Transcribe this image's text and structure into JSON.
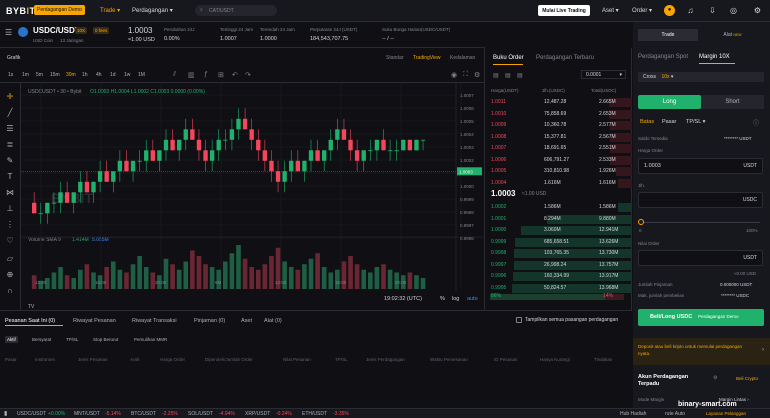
{
  "topnav": {
    "logo_a": "BYB",
    "logo_b": "I",
    "logo_c": "T",
    "demo_badge": "Perdagangan Demo",
    "trade": "Trade",
    "perdagangan": "Perdagangan",
    "search_placeholder": "CAT/USDT",
    "live_btn": "Mulai Live Trading",
    "aset": "Aset",
    "order": "Order"
  },
  "ticker": {
    "symbol": "USDC/USDT",
    "badge_lev": "10X",
    "badge_fee": "0 fees",
    "sub": "USD Coin",
    "sub2": "13 Jaringan",
    "last_price": "1.0003",
    "last_usd": "≈1.00 USD",
    "stats": [
      {
        "label": "Perubahan 24J",
        "value": "0.00%"
      },
      {
        "label": "Tertinggi 24 Jam",
        "value": "1.0007"
      },
      {
        "label": "Terendah 24 Jam",
        "value": "1.0000"
      },
      {
        "label": "Perputaran 24J (USDT)",
        "value": "184,543,707.75"
      },
      {
        "label": "Suku Bunga Harian(USDC/USDT)",
        "value": "-- / --"
      }
    ]
  },
  "chart": {
    "title": "Grafik",
    "views": [
      "Standar",
      "TradingView",
      "Kedalaman"
    ],
    "intervals": [
      "1s",
      "1m",
      "5m",
      "15m",
      "30m",
      "1h",
      "4h",
      "1d",
      "1w",
      "1M"
    ],
    "active_interval": "30m",
    "ohlc_line": "USDCUSDT • 30 • Bybit",
    "ohlc": "O1.0003 H1.0004 L1.0002 C1.0003 0.0000 (0.00%)",
    "volume_label": "Volume SMA 9",
    "vol_a": "1.414M",
    "vol_b": "5.055M",
    "watermark": "BYBIT",
    "yticks": [
      "1.0007",
      "1.0006",
      "1.0005",
      "1.0004",
      "1.0003",
      "1.0002",
      "1.0001",
      "1.0000",
      "0.9999",
      "0.9998",
      "0.9997",
      "0.9996"
    ],
    "price_tag": "1.0003",
    "time_axis": [
      "12:00",
      "16:00",
      "20:00",
      "6M",
      "12:00",
      "16:00",
      "20:00"
    ],
    "clock": "19:02:32 (UTC)",
    "log": "log",
    "auto": "auto",
    "candles": [
      [
        2,
        3,
        1,
        1
      ],
      [
        1,
        2,
        0,
        1
      ],
      [
        1,
        2,
        0,
        2
      ],
      [
        2,
        3,
        1,
        2
      ],
      [
        2,
        4,
        1,
        3
      ],
      [
        3,
        4,
        2,
        2
      ],
      [
        2,
        3,
        1,
        3
      ],
      [
        3,
        5,
        2,
        4
      ],
      [
        4,
        5,
        3,
        3
      ],
      [
        3,
        4,
        2,
        4
      ],
      [
        4,
        6,
        3,
        5
      ],
      [
        5,
        6,
        4,
        4
      ],
      [
        4,
        5,
        3,
        5
      ],
      [
        5,
        7,
        4,
        6
      ],
      [
        6,
        7,
        5,
        5
      ],
      [
        5,
        6,
        4,
        6
      ],
      [
        6,
        7,
        5,
        6
      ],
      [
        6,
        8,
        5,
        7
      ],
      [
        7,
        8,
        6,
        6
      ],
      [
        6,
        7,
        5,
        7
      ],
      [
        7,
        9,
        6,
        8
      ],
      [
        8,
        9,
        7,
        7
      ],
      [
        7,
        8,
        6,
        8
      ],
      [
        8,
        10,
        7,
        9
      ],
      [
        9,
        10,
        8,
        8
      ],
      [
        8,
        9,
        6,
        7
      ],
      [
        7,
        8,
        5,
        6
      ],
      [
        6,
        8,
        5,
        7
      ],
      [
        7,
        9,
        6,
        8
      ],
      [
        8,
        9,
        7,
        8
      ],
      [
        8,
        10,
        7,
        9
      ],
      [
        9,
        11,
        8,
        10
      ],
      [
        10,
        11,
        9,
        9
      ],
      [
        9,
        10,
        7,
        8
      ],
      [
        8,
        9,
        6,
        7
      ],
      [
        7,
        8,
        5,
        6
      ],
      [
        6,
        7,
        4,
        5
      ],
      [
        5,
        6,
        3,
        4
      ],
      [
        4,
        6,
        3,
        5
      ],
      [
        5,
        7,
        4,
        6
      ],
      [
        6,
        7,
        5,
        5
      ],
      [
        5,
        6,
        4,
        6
      ],
      [
        6,
        8,
        5,
        7
      ],
      [
        7,
        8,
        6,
        6
      ],
      [
        6,
        7,
        5,
        7
      ],
      [
        7,
        9,
        6,
        8
      ],
      [
        8,
        10,
        7,
        9
      ],
      [
        9,
        10,
        8,
        8
      ],
      [
        8,
        9,
        6,
        7
      ],
      [
        7,
        8,
        5,
        6
      ],
      [
        6,
        7,
        5,
        7
      ],
      [
        7,
        8,
        6,
        7
      ],
      [
        7,
        8,
        6,
        8
      ],
      [
        8,
        9,
        7,
        7
      ],
      [
        7,
        8,
        6,
        7
      ],
      [
        7,
        8,
        6,
        7
      ],
      [
        7,
        8,
        7,
        8
      ],
      [
        8,
        8,
        7,
        7
      ],
      [
        7,
        8,
        7,
        8
      ],
      [
        8,
        8,
        7,
        8
      ]
    ],
    "volumes": [
      5,
      3,
      4,
      6,
      8,
      5,
      4,
      7,
      9,
      6,
      5,
      8,
      10,
      7,
      6,
      9,
      12,
      8,
      6,
      5,
      11,
      9,
      7,
      10,
      14,
      12,
      9,
      8,
      7,
      10,
      13,
      16,
      11,
      8,
      7,
      9,
      12,
      15,
      10,
      8,
      7,
      9,
      11,
      13,
      8,
      6,
      7,
      10,
      12,
      9,
      7,
      6,
      8,
      9,
      7,
      6,
      5,
      6,
      5,
      4
    ]
  },
  "orderbook": {
    "tabs": [
      "Buku Order",
      "Perdagangan Terbaru"
    ],
    "precision": "0.0001",
    "cols": [
      "Harga(USDT)",
      "Jlh.(USDC)",
      "Total(USDC)"
    ],
    "asks": [
      [
        "1.0011",
        "12,487.28",
        "2.665M"
      ],
      [
        "1.0010",
        "75,858.69",
        "2.653M"
      ],
      [
        "1.0009",
        "10,360.78",
        "2.577M"
      ],
      [
        "1.0008",
        "15,377.81",
        "2.567M"
      ],
      [
        "1.0007",
        "18,691.65",
        "2.551M"
      ],
      [
        "1.0006",
        "606,791.27",
        "2.533M"
      ],
      [
        "1.0005",
        "310,810.98",
        "1.926M"
      ],
      [
        "1.0004",
        "1.616M",
        "1.616M"
      ]
    ],
    "mid_price": "1.0003",
    "mid_usd": "≈1.00 USD",
    "bids": [
      [
        "1.0002",
        "1.586M",
        "1.586M"
      ],
      [
        "1.0001",
        "8.294M",
        "9.880M"
      ],
      [
        "1.0000",
        "3.060M",
        "12.941M"
      ],
      [
        "0.9999",
        "685,658.51",
        "13.626M"
      ],
      [
        "0.9998",
        "103,765.35",
        "13.730M"
      ],
      [
        "0.9997",
        "26,998.24",
        "13.757M"
      ],
      [
        "0.9996",
        "160,334.99",
        "13.917M"
      ],
      [
        "0.9995",
        "50,824.57",
        "13.968M"
      ]
    ],
    "buy_pct": "86%",
    "sell_pct": "14%",
    "buy_ratio": 0.86
  },
  "right": {
    "tab_trade": "Trade",
    "tab_alat": "Alat",
    "new": "NEW",
    "spot": "Perdagangan Spot",
    "margin": "Margin 10X",
    "cross": "Cross",
    "lev": "10x",
    "long": "Long",
    "short": "Short",
    "order_types": [
      "Batas",
      "Pasar",
      "TP/SL"
    ],
    "saldo_label": "Saldo Tersedia",
    "saldo_value": "******** USDT",
    "harga_label": "Harga Order",
    "harga_value": "1.0003",
    "harga_unit": "USDT",
    "jlh_label": "Jlh.",
    "jlh_unit": "USDC",
    "slider_min": "0",
    "slider_max": "100%",
    "nilai_label": "Nilai Order",
    "nilai_unit": "USDT",
    "nilai_approx": "≈0.00 USD",
    "pinjam_label": "Jumlah Pinjaman",
    "pinjam_value": "0.000000 USDT",
    "maks_label": "Mak. jumlah pembelian",
    "maks_value": "******** USDC",
    "buy_btn": "Beli/Long USDC",
    "buy_btn_sub": "Perdagangan Demo",
    "deposit_note": "Deposit atau beli kripto untuk memulai perdagangan nyata.",
    "akun_title": "Akun Perdagangan Terpadu",
    "beli_kripto": "Beli Crypto",
    "mode_label": "Mode Margin",
    "mode_value": "Margin Lintas"
  },
  "bottom": {
    "tabs": [
      "Pesanan Saat Ini (0)",
      "Riwayat Pesanan",
      "Riwayat Transaksi",
      "Pinjaman (0)",
      "Aset",
      "Alat (0)"
    ],
    "toggle_label": "Tampilkan semua pasangan perdagangan",
    "subtabs": [
      "Aktif",
      "Bersyarat",
      "TP/SL",
      "Stop Berurut",
      "Pemulihan MMR"
    ],
    "cols": [
      "Pasar",
      "Instrumen",
      "Jenis Pesanan",
      "Arah",
      "Harga Order",
      "Diperoleh/Jumlah Order",
      "Nilai Pesanan",
      "TP/SL",
      "Jenis Perdagangan",
      "Waktu Pemesanan",
      "ID Pesanan",
      "Hanya Kurangi",
      "Tindakan"
    ]
  },
  "footer": {
    "tickers": [
      [
        "USDC/USDT",
        "+0.00%"
      ],
      [
        "MNT/USDT",
        "-5.14%"
      ],
      [
        "BTC/USDT",
        "-2.25%"
      ],
      [
        "SOL/USDT",
        "-4.94%"
      ],
      [
        "XRP/USDT",
        "-0.24%"
      ],
      [
        "ETH/USDT",
        "-3.35%"
      ]
    ],
    "announce": "Hub Hadiah",
    "route": "rute Auto",
    "support": "Layanan Pelanggan",
    "watermark": "binary-smart.com"
  }
}
